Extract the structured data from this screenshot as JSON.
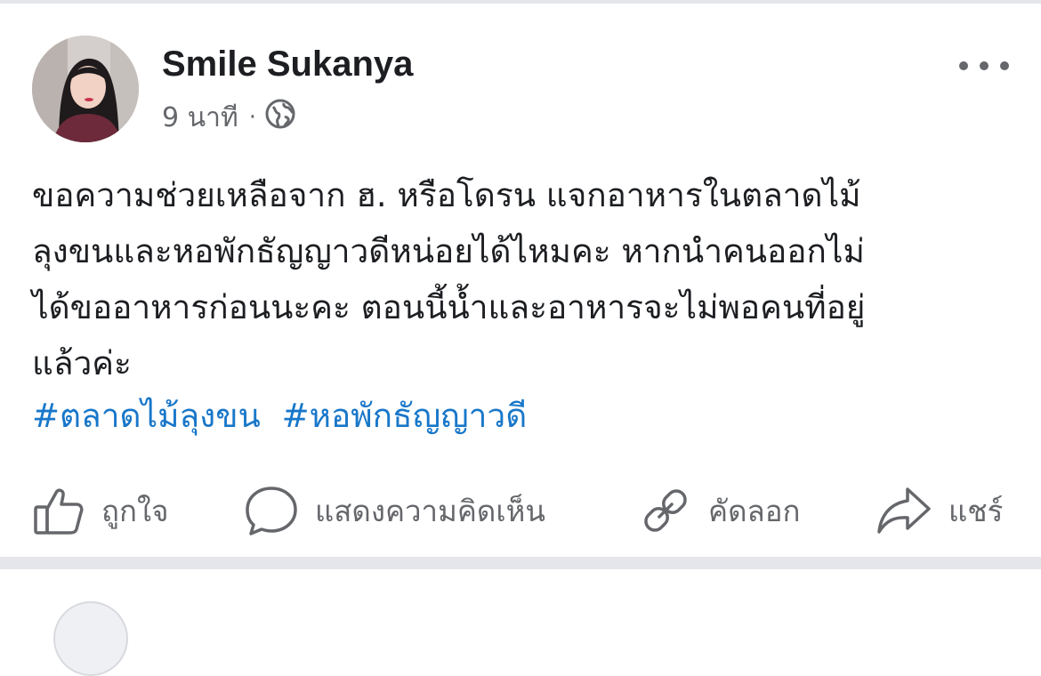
{
  "post": {
    "author": "Smile Sukanya",
    "time": "9 นาที",
    "separator": "·",
    "audience_icon": "globe-icon",
    "more_icon": "more-options-icon",
    "text_lines": [
      "ขอความช่วยเหลือจาก ฮ. หรือโดรน แจกอาหารในตลาดไม้",
      "ลุงขนและหอพักธัญญาวดีหน่อยได้ไหมคะ หากนำคนออกไม่",
      "ได้ขออาหารก่อนนะคะ ตอนนี้น้ำและอาหารจะไม่พอคนที่อยู่",
      "แล้วค่ะ"
    ],
    "hashtags": [
      "#ตลาดไม้ลุงขน",
      "#หอพักธัญญาวดี"
    ]
  },
  "actions": {
    "like": {
      "label": "ถูกใจ",
      "icon": "thumbs-up-icon"
    },
    "comment": {
      "label": "แสดงความคิดเห็น",
      "icon": "comment-bubble-icon"
    },
    "copy": {
      "label": "คัดลอก",
      "icon": "link-icon"
    },
    "share": {
      "label": "แชร์",
      "icon": "share-arrow-icon"
    }
  },
  "colors": {
    "text": "#1c1e21",
    "secondary": "#65676b",
    "hashtag": "#1877c9",
    "divider": "#e5e6eb"
  }
}
